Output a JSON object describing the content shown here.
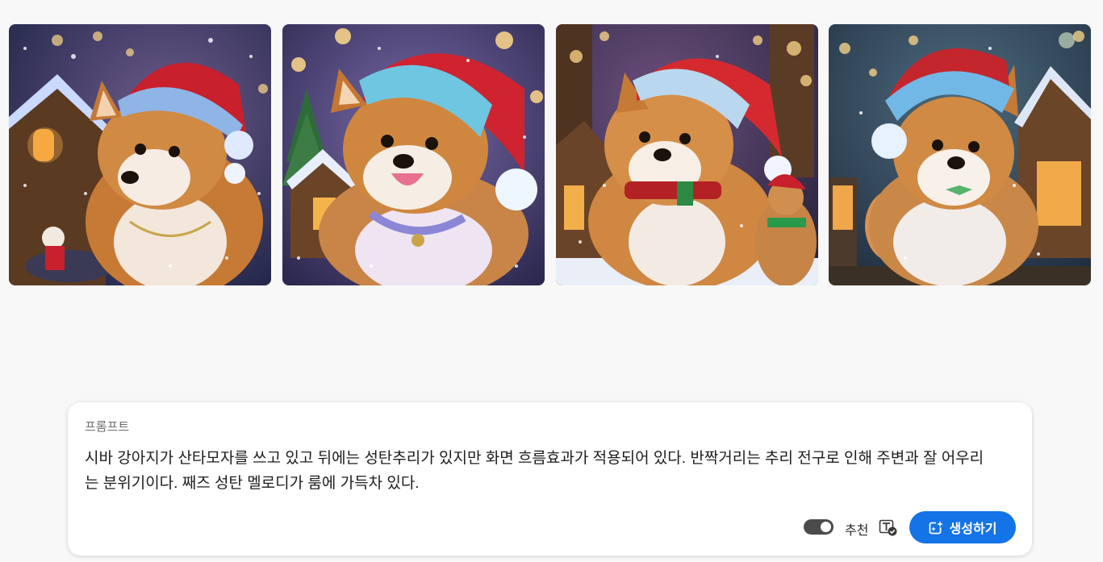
{
  "gallery": {
    "images": [
      {
        "alt": "shiba-santa-1",
        "bg": "#2a2f55",
        "hat": "#c8202c",
        "trim": "#8fb4e6"
      },
      {
        "alt": "shiba-santa-2",
        "bg": "#3b3668",
        "hat": "#cf2330",
        "trim": "#6fc6e0"
      },
      {
        "alt": "shiba-santa-3",
        "bg": "#33304f",
        "hat": "#d42a2f",
        "trim": "#b9d8ef"
      },
      {
        "alt": "shiba-santa-4",
        "bg": "#1f3550",
        "hat": "#c4262d",
        "trim": "#72b8e6"
      }
    ]
  },
  "prompt": {
    "label": "프롬프트",
    "text": "시바 강아지가 산타모자를 쓰고 있고 뒤에는 성탄추리가 있지만 화면 흐름효과가 적용되어 있다. 반짝거리는 추리 전구로 인해 주변과 잘 어우리는 분위기이다. 째즈 성탄 멜로디가 룸에 가득차 있다."
  },
  "controls": {
    "toggle_on": true,
    "recommend_label": "추천",
    "generate_label": "생성하기",
    "accent_color": "#1473e6"
  }
}
